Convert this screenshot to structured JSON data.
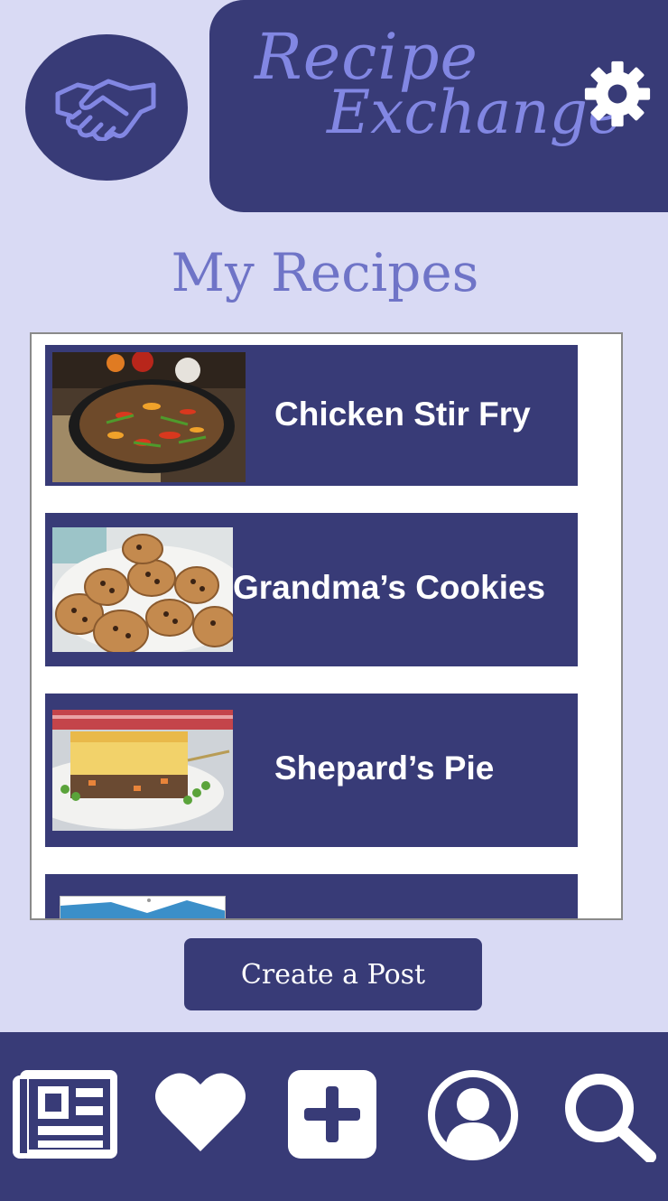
{
  "app": {
    "brand_line1": "Recipe",
    "brand_line2": "Exchange",
    "logo_icon": "handshake-icon",
    "settings_icon": "gear-icon"
  },
  "page": {
    "title": "My Recipes"
  },
  "recipes": [
    {
      "name": "Chicken Stir Fry",
      "image": "stir-fry-photo"
    },
    {
      "name": "Grandma’s Cookies",
      "image": "cookies-photo"
    },
    {
      "name": "Shepard’s Pie",
      "image": "shepherds-pie-photo"
    },
    {
      "name": "",
      "image": "partial-thumbnail"
    }
  ],
  "actions": {
    "create_post": "Create a Post"
  },
  "bottom_nav": [
    {
      "icon": "newspaper-icon"
    },
    {
      "icon": "heart-icon"
    },
    {
      "icon": "plus-icon"
    },
    {
      "icon": "profile-icon"
    },
    {
      "icon": "search-icon"
    }
  ],
  "colors": {
    "background": "#d9daf4",
    "primary": "#383b77",
    "accent": "#8287e3",
    "title": "#6f74c7",
    "white": "#ffffff"
  }
}
